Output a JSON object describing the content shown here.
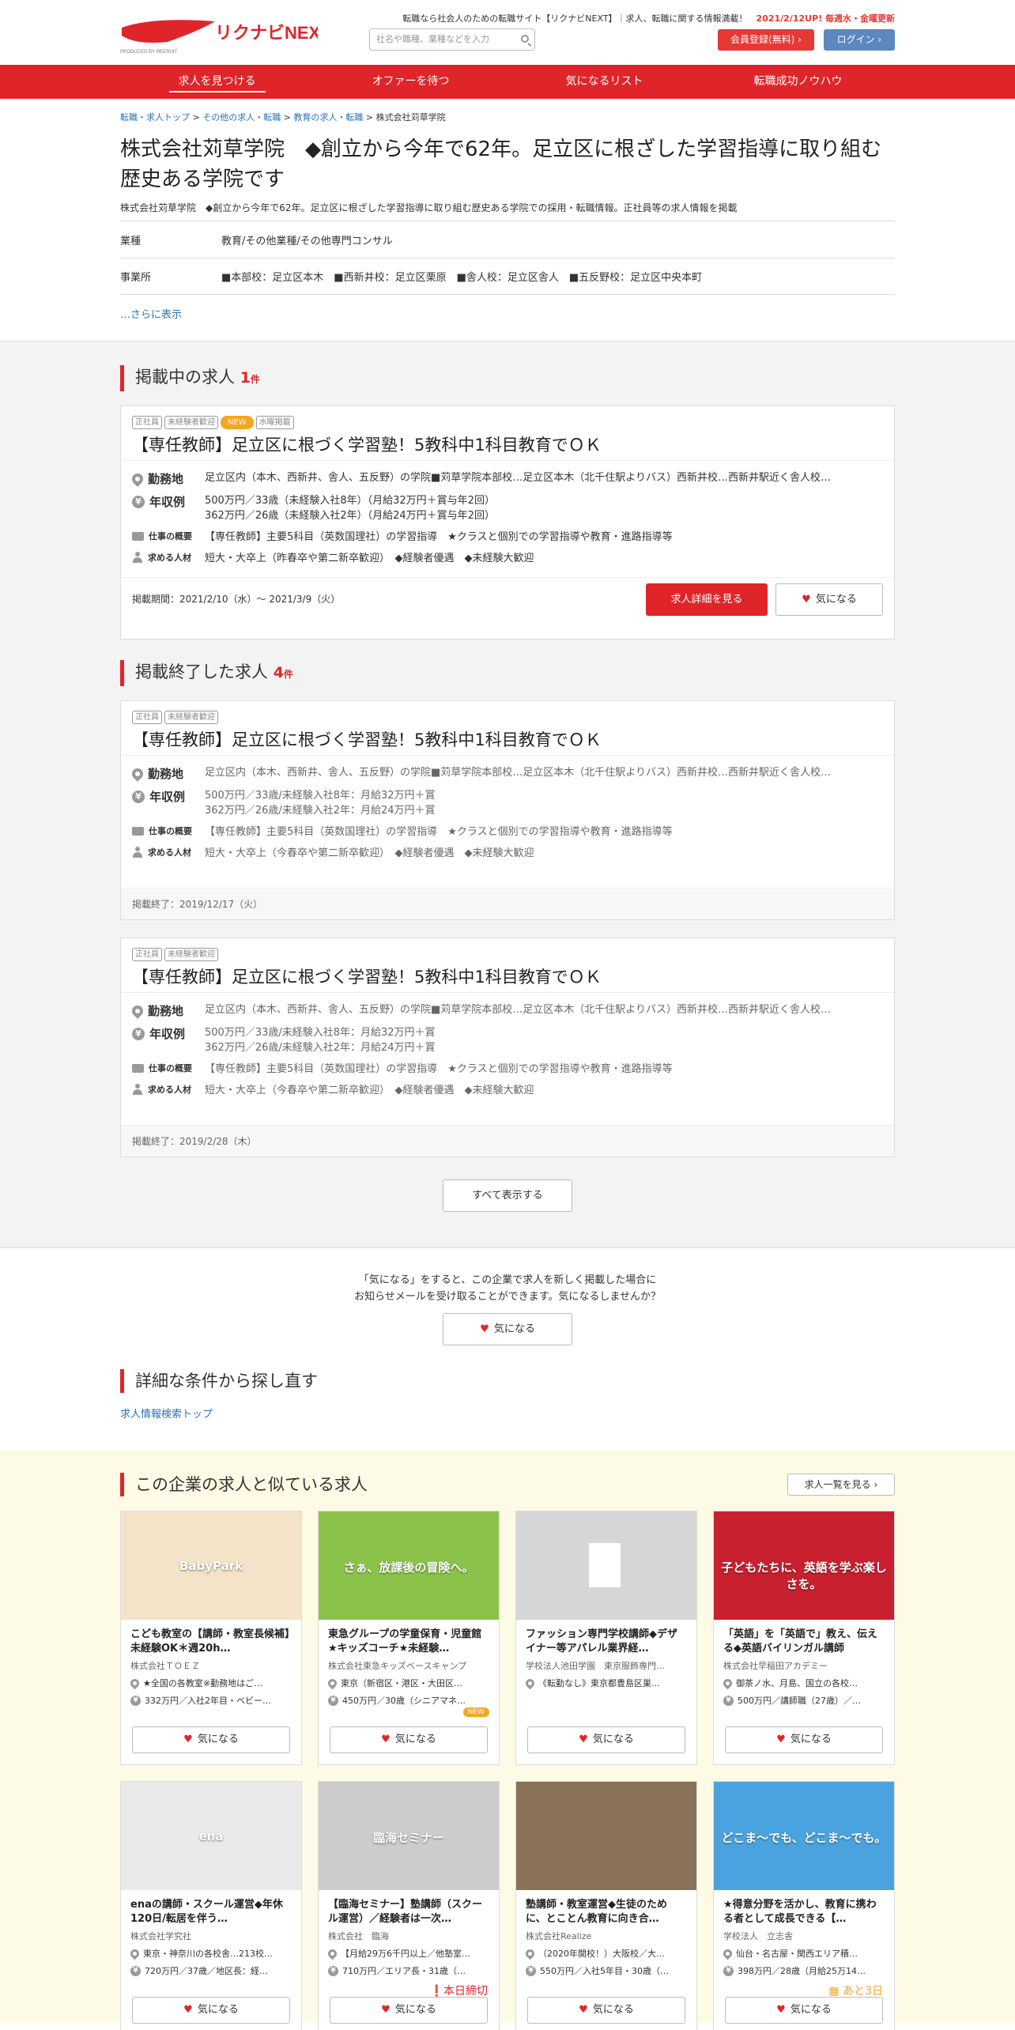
{
  "header": {
    "logo_text": "リクナビNEXT",
    "logo_sub": "PRODUCED BY RECRUIT",
    "tagline": "転職なら社会人のための転職サイト【リクナビNEXT】｜求人、転職に関する情報満載！",
    "update_note": "2021/2/12UP! 毎週水・金曜更新",
    "search_placeholder": "社名や職種、業種などを入力",
    "register_label": "会員登録(無料)",
    "login_label": "ログイン"
  },
  "nav": [
    "求人を見つける",
    "オファーを待つ",
    "気になるリスト",
    "転職成功ノウハウ"
  ],
  "breadcrumb": [
    "転職・求人トップ",
    "その他の求人・転職",
    "教育の求人・転職",
    "株式会社苅草学院"
  ],
  "company": {
    "title": "株式会社苅草学院　◆創立から今年で62年。足立区に根ざした学習指導に取り組む歴史ある学院です",
    "subtitle": "株式会社苅草学院　◆創立から今年で62年。足立区に根ざした学習指導に取り組む歴史ある学院での採用・転職情報。正社員等の求人情報を掲載",
    "industry_label": "業種",
    "industry": "教育/その他業種/その他専門コンサル",
    "office_label": "事業所",
    "office": "■本部校：足立区本木　■西新井校：足立区栗原　■舎人校：足立区舎人　■五反野校：足立区中央本町",
    "more": "…さらに表示"
  },
  "active_section": {
    "title": "掲載中の求人",
    "count": "1",
    "unit": "件"
  },
  "ended_section": {
    "title": "掲載終了した求人",
    "count": "4",
    "unit": "件"
  },
  "labels": {
    "location": "勤務地",
    "salary": "年収例",
    "summary": "仕事の概要",
    "wanted": "求める人材",
    "detail": "求人詳細を見る",
    "fav": "気になる"
  },
  "active_job": {
    "tags": [
      "正社員",
      "未経験者歓迎",
      "NEW",
      "水曜掲載"
    ],
    "title": "【専任教師】足立区に根づく学習塾！5教科中1科目教育でＯＫ",
    "location": "足立区内（本木、西新井、舎人、五反野）の学院■苅草学院本部校…足立区本木（北千住駅よりバス）西新井校…西新井駅近く舎人校…",
    "salary1": "500万円／33歳（未経験入社8年）（月給32万円＋賞与年2回）",
    "salary2": "362万円／26歳（未経験入社2年）（月給24万円＋賞与年2回）",
    "summary": "【専任教師】主要5科目（英数国理社）の学習指導　★クラスと個別での学習指導や教育・進路指導等",
    "wanted": "短大・大卒上（昨春卒や第二新卒歓迎）　◆経験者優遇　◆未経験大歓迎",
    "period": "掲載期間：2021/2/10（水）～ 2021/3/9（火）"
  },
  "ended_jobs": [
    {
      "tags": [
        "正社員",
        "未経験者歓迎"
      ],
      "title": "【専任教師】足立区に根づく学習塾！5教科中1科目教育でＯＫ",
      "location": "足立区内（本木、西新井、舎人、五反野）の学院■苅草学院本部校…足立区本木（北千住駅よりバス）西新井校…西新井駅近く舎人校…",
      "salary1": "500万円／33歳/未経験入社8年：月給32万円＋賞",
      "salary2": "362万円／26歳/未経験入社2年：月給24万円＋賞",
      "summary": "【専任教師】主要5科目（英数国理社）の学習指導　★クラスと個別での学習指導や教育・進路指導等",
      "wanted": "短大・大卒上（今春卒や第二新卒歓迎）　◆経験者優遇　◆未経験大歓迎",
      "ended": "掲載終了：2019/12/17（火）"
    },
    {
      "tags": [
        "正社員",
        "未経験者歓迎"
      ],
      "title": "【専任教師】足立区に根づく学習塾！5教科中1科目教育でＯＫ",
      "location": "足立区内（本木、西新井、舎人、五反野）の学院■苅草学院本部校…足立区本木（北千住駅よりバス）西新井校…西新井駅近く舎人校…",
      "salary1": "500万円／33歳/未経験入社8年：月給32万円＋賞",
      "salary2": "362万円／26歳/未経験入社2年：月給24万円＋賞",
      "summary": "【専任教師】主要5科目（英数国理社）の学習指導　★クラスと個別での学習指導や教育・進路指導等",
      "wanted": "短大・大卒上（今春卒や第二新卒歓迎）　◆経験者優遇　◆未経験大歓迎",
      "ended": "掲載終了：2019/2/28（木）"
    }
  ],
  "show_all": "すべて表示する",
  "fav_note1": "「気になる」をすると、この企業で求人を新しく掲載した場合に",
  "fav_note2": "お知らせメールを受け取ることができます。気になるしませんか？",
  "search_again": {
    "title": "詳細な条件から探し直す",
    "link": "求人情報検索トップ"
  },
  "similar": {
    "title": "この企業の求人と似ている求人",
    "list_button": "求人一覧を見る",
    "items": [
      {
        "title": "こども教室の【講師・教室長候補】未経験OK＊週20h…",
        "company": "株式会社ＴＯＥＺ",
        "location": "★全国の各教室※勤務地はご…",
        "salary": "332万円／入社2年目・ベビー…",
        "img_text": "BabyPark",
        "badge": "",
        "img_color": "#f4e3c9"
      },
      {
        "title": "東急グループの学童保育・児童館★キッズコーチ★未経験…",
        "company": "株式会社東急キッズベースキャンプ",
        "location": "東京（新宿区・港区・大田区…",
        "salary": "450万円／30歳（シニアマネ…",
        "img_text": "さぁ、放課後の冒険へ。",
        "badge": "NEW",
        "img_color": "#8bc34a"
      },
      {
        "title": "ファッション専門学校講師◆デザイナー等アパレル業界経…",
        "company": "学校法人池田学園　東京服飾専門…",
        "location": "《転勤なし》東京都豊島区巣…",
        "salary": "",
        "img_text": "",
        "badge": "",
        "img_color": "#d6d6d6"
      },
      {
        "title": "「英語」を「英語で」教え、伝える◆英語バイリンガル講師",
        "company": "株式会社早稲田アカデミー",
        "location": "御茶ノ水、月島、国立の各校…",
        "salary": "500万円／講師職（27歳）／…",
        "img_text": "子どもたちに、英語を学ぶ楽しさを。",
        "badge": "",
        "img_color": "#c8202e"
      },
      {
        "title": "enaの講師・スクール運営◆年休120日/転居を伴う…",
        "company": "株式会社学究社",
        "location": "東京・神奈川の各校舎…213校…",
        "salary": "720万円／37歳／地区長：経…",
        "img_text": "ena",
        "badge": "",
        "img_color": "#eaeaea"
      },
      {
        "title": "【臨海セミナー】塾講師（スクール運営）／経験者は一次…",
        "company": "株式会社　臨海",
        "location": "【月給29万6千円以上／他塾室…",
        "salary": "710万円／エリア長・31歳（…",
        "img_text": "臨海セミナー",
        "badge": "本日締切",
        "img_color": "#cccccc"
      },
      {
        "title": "塾講師・教室運営◆生徒のために、とことん教育に向き合…",
        "company": "株式会社Realize",
        "location": "（2020年開校！）大阪校／大…",
        "salary": "550万円／入社5年目・30歳（…",
        "img_text": "",
        "badge": "",
        "img_color": "#8a7258"
      },
      {
        "title": "★得意分野を活かし、教育に携わる者として成長できる【…",
        "company": "学校法人　立志舎",
        "location": "仙台・名古屋・関西エリア積…",
        "salary": "398万円／28歳（月給25万14…",
        "img_text": "どこま〜でも、どこま〜でも。",
        "badge": "あと3日",
        "img_color": "#4aa3df"
      }
    ]
  }
}
